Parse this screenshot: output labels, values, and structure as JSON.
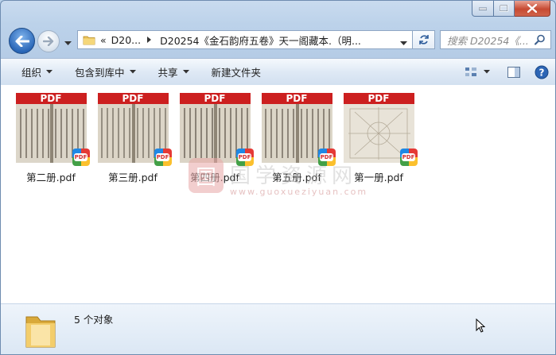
{
  "window": {
    "accent": "#2a67b8",
    "close_color": "#c74a32"
  },
  "address": {
    "crumbs": [
      {
        "label": "«"
      },
      {
        "label": "D20..."
      },
      {
        "label": "D20254《金石韵府五卷》天一阁藏本.（明..."
      }
    ]
  },
  "search": {
    "placeholder": "搜索 D20254《..."
  },
  "commands": [
    {
      "label": "组织",
      "has_menu": true
    },
    {
      "label": "包含到库中",
      "has_menu": true
    },
    {
      "label": "共享",
      "has_menu": true
    },
    {
      "label": "新建文件夹",
      "has_menu": false
    }
  ],
  "files": [
    {
      "name": "第二册.pdf",
      "badge": "PDF",
      "header": "PDF"
    },
    {
      "name": "第三册.pdf",
      "badge": "PDF",
      "header": "PDF"
    },
    {
      "name": "第四册.pdf",
      "badge": "PDF",
      "header": "PDF"
    },
    {
      "name": "第五册.pdf",
      "badge": "PDF",
      "header": "PDF"
    },
    {
      "name": "第一册.pdf",
      "badge": "PDF",
      "header": "PDF"
    }
  ],
  "watermark": {
    "title": "国学资源网",
    "url": "www.guoxueziyuan.com",
    "seal": "国"
  },
  "status": {
    "count_text": "5 个对象"
  }
}
